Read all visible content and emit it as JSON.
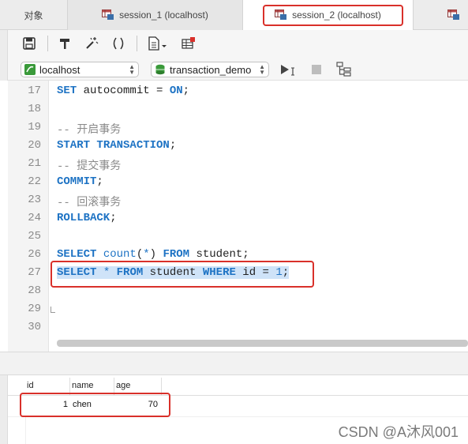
{
  "tabs": {
    "objects": "对象",
    "session1": "session_1 (localhost)",
    "session2": "session_2 (localhost)"
  },
  "toolbar": {
    "icons": [
      "save-icon",
      "format-icon",
      "beautify-icon",
      "parentheses-icon",
      "snippet-icon",
      "export-query-icon"
    ]
  },
  "connection": {
    "host": "localhost",
    "database": "transaction_demo"
  },
  "editor": {
    "lines": [
      {
        "num": "17",
        "text": "SET autocommit = ON;"
      },
      {
        "num": "18",
        "text": ""
      },
      {
        "num": "19",
        "text": "-- 开启事务"
      },
      {
        "num": "20",
        "text": "START TRANSACTION;"
      },
      {
        "num": "21",
        "text": "-- 提交事务"
      },
      {
        "num": "22",
        "text": "COMMIT;"
      },
      {
        "num": "23",
        "text": "-- 回滚事务"
      },
      {
        "num": "24",
        "text": "ROLLBACK;"
      },
      {
        "num": "25",
        "text": ""
      },
      {
        "num": "26",
        "text": "SELECT count(*) FROM student;"
      },
      {
        "num": "27",
        "text": "SELECT * FROM student WHERE id = 1;"
      },
      {
        "num": "28",
        "text": ""
      },
      {
        "num": "29",
        "text": ""
      },
      {
        "num": "30",
        "text": ""
      }
    ]
  },
  "results": {
    "columns": [
      "id",
      "name",
      "age"
    ],
    "rows": [
      {
        "id": "1",
        "name": "chen",
        "age": "70"
      }
    ]
  },
  "watermark": "CSDN @A沐风001",
  "colors": {
    "keyword": "#1e73c4",
    "comment": "#8a8a8a",
    "highlight": "#d9302a",
    "selection": "#cfe3f8"
  }
}
